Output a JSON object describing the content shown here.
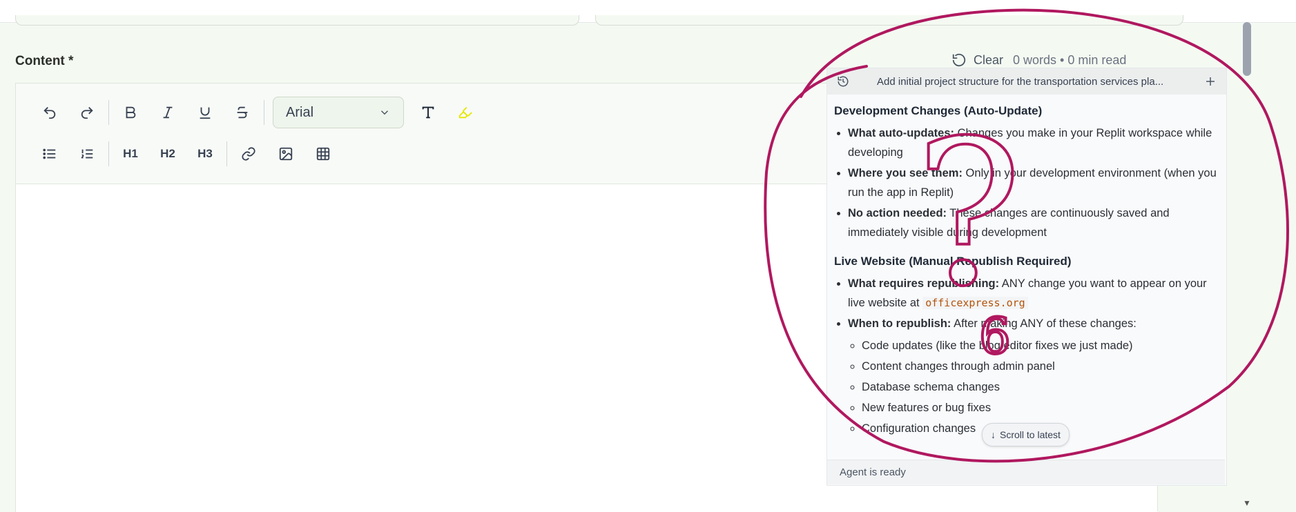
{
  "content": {
    "label": "Content *",
    "clear_label": "Clear",
    "stats": "0 words • 0 min read"
  },
  "toolbar": {
    "font_value": "Arial",
    "h1": "H1",
    "h2": "H2",
    "h3": "H3",
    "highlight_color": "#e6e600"
  },
  "agent": {
    "title": "Add initial project structure for the transportation services pla...",
    "sections": [
      {
        "heading": "Development Changes (Auto-Update)",
        "items": [
          {
            "bold": "What auto-updates:",
            "text": " Changes you make in your Replit workspace while developing"
          },
          {
            "bold": "Where you see them:",
            "text": " Only in your development environment (when you run the app in Replit)"
          },
          {
            "bold": "No action needed:",
            "text": " These changes are continuously saved and immediately visible during development"
          }
        ]
      },
      {
        "heading": "Live Website (Manual Republish Required)",
        "items": [
          {
            "bold": "What requires republishing:",
            "text": " ANY change you want to appear on your live website at ",
            "code": "officexpress.org"
          },
          {
            "bold": "When to republish:",
            "text": " After making ANY of these changes:"
          }
        ],
        "subitems": [
          "Code updates (like the blog editor fixes we just made)",
          "Content changes through admin panel",
          "Database schema changes",
          "New features or bug fixes",
          "Configuration changes"
        ]
      }
    ],
    "scroll_latest": "Scroll to latest",
    "status": "Agent is ready"
  },
  "annotation": {
    "color": "#b0185f",
    "question_mark": "?",
    "digit": "6"
  }
}
